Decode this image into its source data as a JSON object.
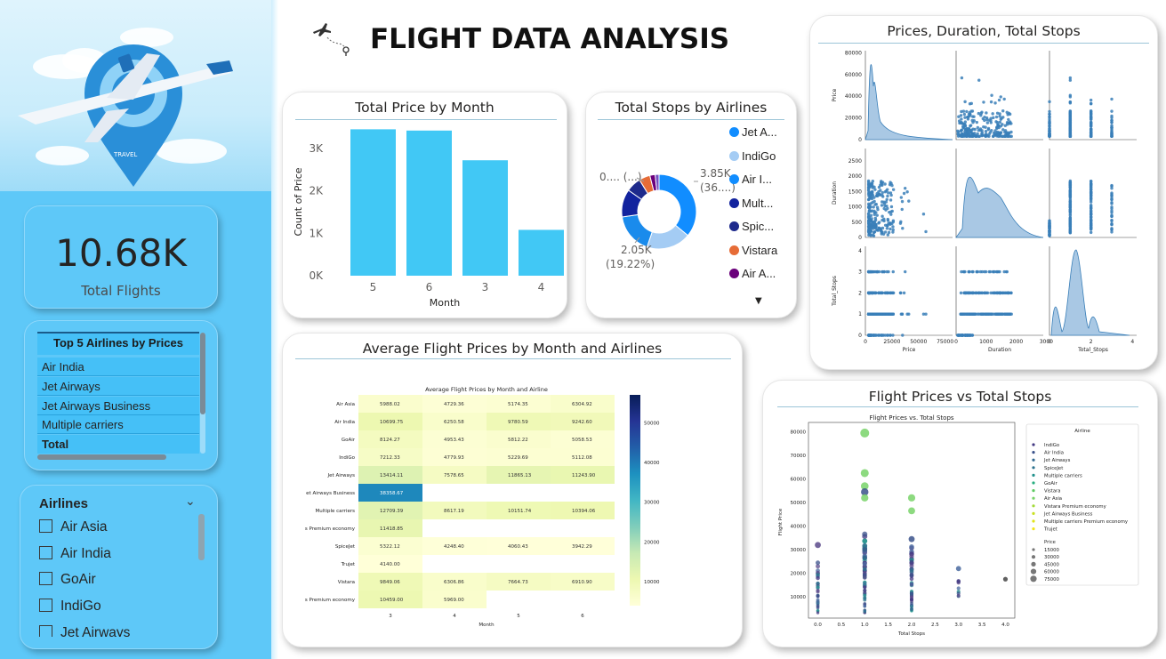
{
  "header": {
    "title": "FLIGHT DATA ANALYSIS"
  },
  "kpi": {
    "value": "10.68K",
    "label": "Total Flights"
  },
  "top_airlines": {
    "header": "Top 5 Airlines by Prices",
    "rows": [
      "Air India",
      "Jet Airways",
      "Jet Airways Business",
      "Multiple carriers",
      "Total"
    ]
  },
  "airline_slicer": {
    "header": "Airlines",
    "items": [
      "Air Asia",
      "Air India",
      "GoAir",
      "IndiGo",
      "Jet Airways"
    ]
  },
  "colors": {
    "sidebar": "#5ec8f8",
    "bar": "#41c8f5",
    "accent_blue": "#118dff"
  },
  "chart_data": [
    {
      "id": "price-by-month",
      "type": "bar",
      "title": "Total Price by Month",
      "xlabel": "Month",
      "ylabel": "Count of Price",
      "categories": [
        "5",
        "6",
        "3",
        "4"
      ],
      "values": [
        3450,
        3420,
        2720,
        1080
      ],
      "ylim": [
        0,
        3500
      ],
      "yticks": [
        "0K",
        "1K",
        "2K",
        "3K"
      ],
      "ytick_values": [
        0,
        1000,
        2000,
        3000
      ]
    },
    {
      "id": "stops-by-airlines",
      "type": "pie",
      "title": "Total Stops by Airlines",
      "legend": [
        "Jet A...",
        "IndiGo",
        "Air I...",
        "Mult...",
        "Spic...",
        "Vistara",
        "Air A..."
      ],
      "legend_colors": [
        "#118dff",
        "#a4ccf4",
        "#118dff",
        "#12239e",
        "#1e2a8c",
        "#e66c37",
        "#6b007b"
      ],
      "slices": [
        {
          "value": 36.0,
          "color": "#118dff"
        },
        {
          "value": 19.22,
          "color": "#a4ccf4"
        },
        {
          "value": 17.5,
          "color": "#1a8bec"
        },
        {
          "value": 12.0,
          "color": "#12239e"
        },
        {
          "value": 6.5,
          "color": "#1e2a8c"
        },
        {
          "value": 4.8,
          "color": "#e66c37"
        },
        {
          "value": 2.3,
          "color": "#6b007b"
        },
        {
          "value": 1.68,
          "color": "#744ec2"
        }
      ],
      "labels": {
        "top_right": "3.85K",
        "top_right_pct": "(36....)",
        "bottom_left": "2.05K",
        "bottom_left_pct": "(19.22%)",
        "top_left": "0.... (...)"
      }
    },
    {
      "id": "avg-price-heatmap",
      "type": "heatmap",
      "title": "Average Flight Prices by Month and Airlines",
      "subtitle": "Average Flight Prices by Month and Airline",
      "xlabel": "Month",
      "columns": [
        "3",
        "4",
        "5",
        "6"
      ],
      "rows": [
        "Air Asia",
        "Air India",
        "GoAir",
        "IndiGo",
        "Jet Airways",
        "et Airways Business",
        "Multiple carriers",
        "s Premium economy",
        "SpiceJet",
        "Trujet",
        "Vistara",
        "s Premium economy"
      ],
      "values": [
        [
          5988.02,
          4729.36,
          5174.35,
          6304.92
        ],
        [
          10699.75,
          6250.58,
          9780.59,
          9242.6
        ],
        [
          8124.27,
          4953.43,
          5812.22,
          5058.53
        ],
        [
          7212.33,
          4779.93,
          5229.69,
          5112.08
        ],
        [
          13414.11,
          7578.65,
          11865.13,
          11243.9
        ],
        [
          38358.67,
          null,
          null,
          null
        ],
        [
          12709.39,
          8617.19,
          10151.74,
          10394.06
        ],
        [
          11418.85,
          null,
          null,
          null
        ],
        [
          5322.12,
          4248.4,
          4060.43,
          3942.29
        ],
        [
          4140.0,
          null,
          null,
          null
        ],
        [
          9849.06,
          6306.86,
          7664.73,
          6910.9
        ],
        [
          10459.0,
          5969.0,
          null,
          null
        ]
      ],
      "value_labels": [
        [
          "5988.02",
          "4729.36",
          "5174.35",
          "6304.92"
        ],
        [
          "10699.75",
          "6250.58",
          "9780.59",
          "9242.60"
        ],
        [
          "8124.27",
          "4953.43",
          "5812.22",
          "5058.53"
        ],
        [
          "7212.33",
          "4779.93",
          "5229.69",
          "5112.08"
        ],
        [
          "13414.11",
          "7578.65",
          "11865.13",
          "11243.90"
        ],
        [
          "38358.67",
          "",
          "",
          ""
        ],
        [
          "12709.39",
          "8617.19",
          "10151.74",
          "10394.06"
        ],
        [
          "11418.85",
          "",
          "",
          ""
        ],
        [
          "5322.12",
          "4248.40",
          "4060.43",
          "3942.29"
        ],
        [
          "4140.00",
          "",
          "",
          ""
        ],
        [
          "9849.06",
          "6306.86",
          "7664.73",
          "6910.90"
        ],
        [
          "10459.00",
          "5969.00",
          "",
          ""
        ]
      ],
      "colorbar_ticks": [
        "10000",
        "20000",
        "30000",
        "40000",
        "50000"
      ],
      "colorbar_tick_values": [
        10000,
        20000,
        30000,
        40000,
        50000
      ],
      "vmin": 4000,
      "vmax": 57000
    },
    {
      "id": "pairplot",
      "type": "scatter",
      "title": "Prices, Duration, Total Stops",
      "variables": [
        "Price",
        "Duration",
        "Total_Stops"
      ],
      "axis_ticks": {
        "Price": [
          "0",
          "20000",
          "40000",
          "60000",
          "80000"
        ],
        "Price_x": [
          "0",
          "25000",
          "50000",
          "75000"
        ],
        "Duration": [
          "0",
          "500",
          "1000",
          "1500",
          "2000",
          "2500"
        ],
        "Duration_x": [
          "0",
          "1000",
          "2000",
          "3000"
        ],
        "Total_Stops": [
          "0",
          "1",
          "2",
          "3",
          "4"
        ],
        "Total_Stops_x": [
          "0",
          "2",
          "4"
        ]
      },
      "ranges": {
        "Price": [
          0,
          82000
        ],
        "Duration": [
          0,
          2900
        ],
        "Total_Stops": [
          0,
          4.2
        ]
      }
    },
    {
      "id": "price-vs-stops",
      "type": "scatter",
      "title": "Flight Prices vs Total Stops",
      "subtitle": "Flight Prices vs. Total Stops",
      "xlabel": "Total Stops",
      "ylabel": "Flight Price",
      "xticks": [
        "0.0",
        "0.5",
        "1.0",
        "1.5",
        "2.0",
        "2.5",
        "3.0",
        "3.5",
        "4.0"
      ],
      "xtick_values": [
        0,
        0.5,
        1,
        1.5,
        2,
        2.5,
        3,
        3.5,
        4
      ],
      "yticks": [
        "10000",
        "20000",
        "30000",
        "40000",
        "50000",
        "60000",
        "70000",
        "80000"
      ],
      "ytick_values": [
        10000,
        20000,
        30000,
        40000,
        50000,
        60000,
        70000,
        80000
      ],
      "xlim": [
        -0.2,
        4.2
      ],
      "ylim": [
        1000,
        84000
      ],
      "legend_title": "Airline",
      "legend_airlines": [
        "IndiGo",
        "Air India",
        "Jet Airways",
        "SpiceJet",
        "Multiple carriers",
        "GoAir",
        "Vistara",
        "Air Asia",
        "Vistara Premium economy",
        "Jet Airways Business",
        "Multiple carriers Premium economy",
        "Trujet"
      ],
      "legend_size_title": "Price",
      "legend_sizes": [
        "15000",
        "30000",
        "45000",
        "60000",
        "75000"
      ],
      "points": [
        {
          "x": 1,
          "y": 79500,
          "c": "#79d36a",
          "s": 5
        },
        {
          "x": 1,
          "y": 62500,
          "c": "#79d36a",
          "s": 4.5
        },
        {
          "x": 1,
          "y": 57000,
          "c": "#79d36a",
          "s": 4.3
        },
        {
          "x": 1,
          "y": 54500,
          "c": "#3b528b",
          "s": 4.2
        },
        {
          "x": 1,
          "y": 52000,
          "c": "#79d36a",
          "s": 4.1
        },
        {
          "x": 2,
          "y": 52000,
          "c": "#79d36a",
          "s": 4.1
        },
        {
          "x": 2,
          "y": 46500,
          "c": "#79d36a",
          "s": 3.9
        },
        {
          "x": 0,
          "y": 32000,
          "c": "#5b4a8b",
          "s": 3.4
        },
        {
          "x": 2,
          "y": 34500,
          "c": "#3b528b",
          "s": 3.4
        },
        {
          "x": 3,
          "y": 22000,
          "c": "#4a6aa0",
          "s": 2.9
        },
        {
          "x": 4,
          "y": 17500,
          "c": "#444",
          "s": 2.6
        }
      ]
    }
  ]
}
